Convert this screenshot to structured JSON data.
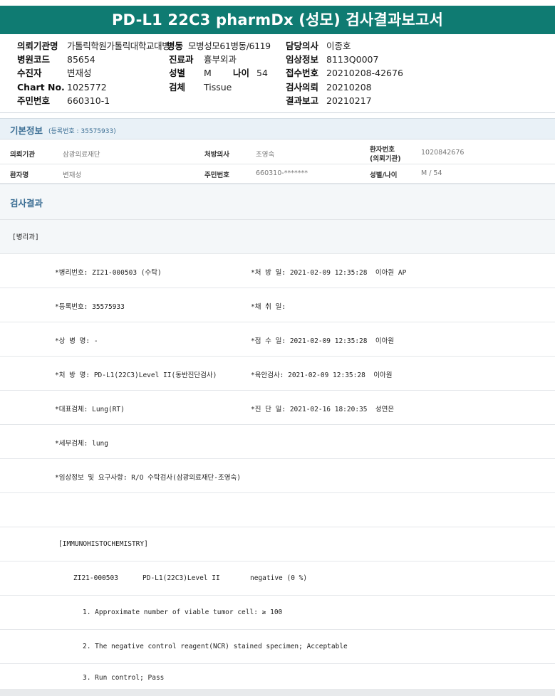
{
  "title": "PD-L1 22C3 pharmDx (성모) 검사결과보고서",
  "header": {
    "col1": [
      {
        "label": "의뢰기관명",
        "value": "가톨릭학원가톨릭대학교대병"
      },
      {
        "label": "병원코드",
        "value": "85654"
      },
      {
        "label": "수진자",
        "value": "변재성"
      },
      {
        "label": "Chart No.",
        "value": "1025772"
      },
      {
        "label": "주민번호",
        "value": "660310-1"
      }
    ],
    "col2": [
      {
        "label": "병동",
        "value": "모병성모61병동/6119"
      },
      {
        "label": "진료과",
        "value": "흉부외과"
      },
      {
        "label": "성별",
        "value": "M"
      },
      {
        "label": "검체",
        "value": "Tissue"
      }
    ],
    "age": {
      "label": "나이",
      "value": "54"
    },
    "col3": [
      {
        "label": "담당의사",
        "value": "이종호"
      },
      {
        "label": "임상정보",
        "value": "8113Q0007"
      },
      {
        "label": "접수번호",
        "value": "20210208-42676"
      },
      {
        "label": "검사의뢰",
        "value": "20210208"
      },
      {
        "label": "결과보고",
        "value": "20210217"
      }
    ]
  },
  "basic_info": {
    "title": "기본정보",
    "reg_no": "(등록번호 : 35575933)",
    "row1": {
      "k1": "의뢰기관",
      "v1": "삼광의료재단",
      "k2": "처방의사",
      "v2": "조영숙",
      "k3a": "환자번호",
      "k3b": "(의뢰기관)",
      "v3": "1020842676"
    },
    "row2": {
      "k1": "환자명",
      "v1": "변재성",
      "k2": "주민번호",
      "v2": "660310-*******",
      "k3": "성별/나이",
      "v3": "M / 54"
    }
  },
  "results": {
    "title": "검사결과",
    "dept": "[병리과]",
    "lines": [
      {
        "left": "*병리번호: ZI21-000503 (수탁)",
        "right": "*처 방 일: 2021-02-09 12:35:28  이아원 AP"
      },
      {
        "left": "*등록번호: 35575933",
        "right": "*채 취 일:"
      },
      {
        "left": "*상 병 명: -",
        "right": "*접 수 일: 2021-02-09 12:35:28  이아원"
      },
      {
        "left": "*처 방 명: PD-L1(22C3)Level II(동반진단검사)",
        "right": "*육안검사: 2021-02-09 12:35:28  이아원"
      },
      {
        "left": "*대표검체: Lung(RT)",
        "right": "*진 단 일: 2021-02-16 18:20:35  성연은"
      },
      {
        "left": "*세부검체: lung",
        "right": ""
      },
      {
        "left": "*임상정보 및 요구사항: R/O 수탁검사(삼광의료재단-조영숙)",
        "right": ""
      }
    ],
    "ihc_header": "[IMMUNOHISTOCHEMISTRY]",
    "ihc_row": {
      "id": "ZI21-000503",
      "test": "PD-L1(22C3)Level II",
      "result": "negative (0 %)"
    },
    "items": [
      "1. Approximate number of viable tumor cell: ≥ 100",
      "2. The negative control reagent(NCR) stained specimen; Acceptable",
      "3. Run control; Pass"
    ]
  }
}
